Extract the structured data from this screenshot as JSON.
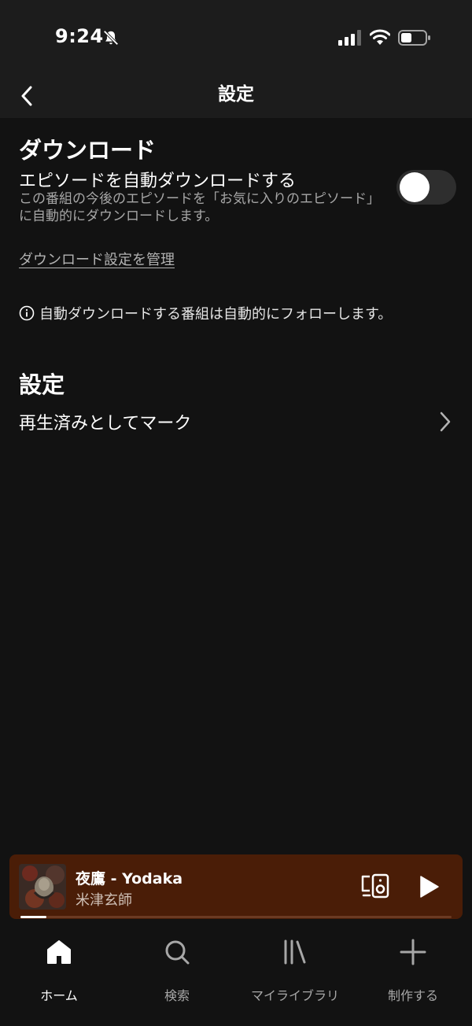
{
  "status_bar": {
    "time": "9:24"
  },
  "header": {
    "title": "設定"
  },
  "download_section": {
    "title": "ダウンロード",
    "auto_download_label": "エピソードを自動ダウンロードする",
    "auto_download_desc": "この番組の今後のエピソードを「お気に入りのエピソード」に自動的にダウンロードします。",
    "auto_download_enabled": false,
    "manage_link": "ダウンロード設定を管理",
    "info_text": "自動ダウンロードする番組は自動的にフォローします。"
  },
  "settings_section": {
    "title": "設定",
    "mark_played_label": "再生済みとしてマーク"
  },
  "now_playing": {
    "title": "夜鷹 - Yodaka",
    "artist": "米津玄師",
    "progress": 0.06
  },
  "tabs": [
    {
      "label": "ホーム",
      "icon": "home-icon",
      "active": true
    },
    {
      "label": "検索",
      "icon": "search-icon",
      "active": false
    },
    {
      "label": "マイライブラリ",
      "icon": "library-icon",
      "active": false
    },
    {
      "label": "制作する",
      "icon": "plus-icon",
      "active": false
    }
  ],
  "colors": {
    "background": "#121212",
    "header": "#1c1c1c",
    "mini_player": "#4a1d07",
    "secondary_text": "#a7a7a7"
  }
}
